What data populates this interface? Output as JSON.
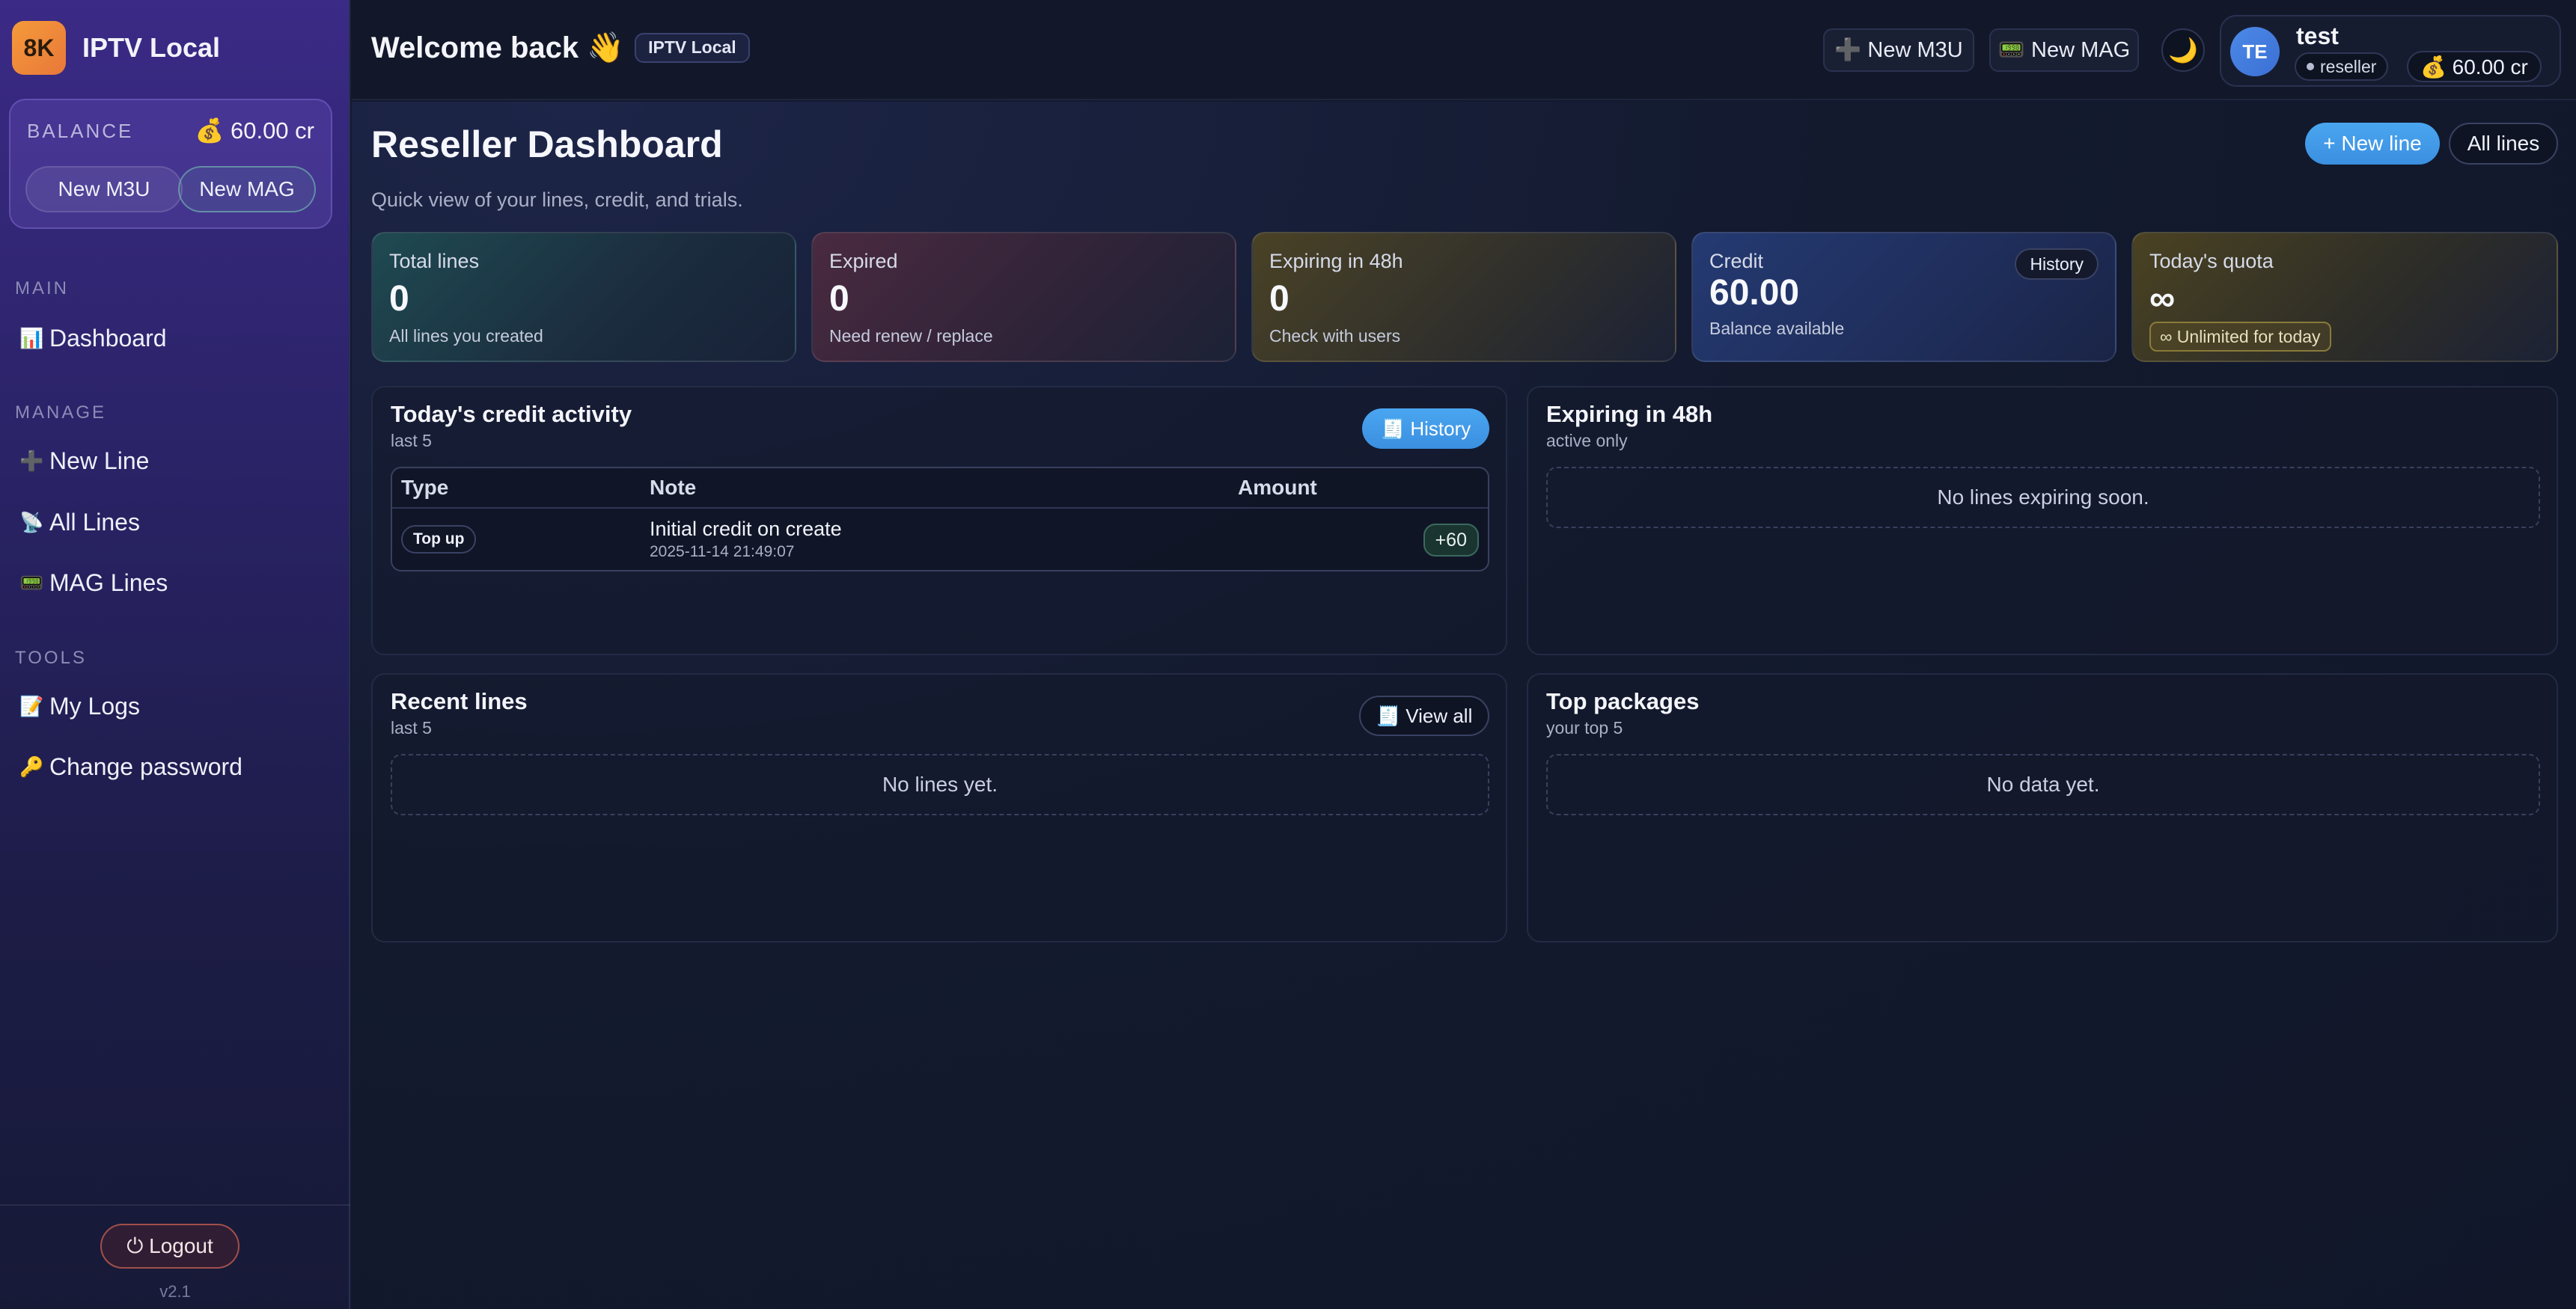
{
  "brand": {
    "logo_text": "8K",
    "name": "IPTV Local"
  },
  "balance": {
    "label": "BALANCE",
    "value": "💰 60.00 cr",
    "new_m3u": "New M3U",
    "new_mag": "New MAG"
  },
  "nav": {
    "main_label": "MAIN",
    "dashboard": {
      "icon": "📊",
      "label": "Dashboard"
    },
    "manage_label": "MANAGE",
    "new_line": {
      "icon": "➕",
      "label": "New Line"
    },
    "all_lines": {
      "icon": "📡",
      "label": "All Lines"
    },
    "mag_lines": {
      "icon": "📟",
      "label": "MAG Lines"
    },
    "tools_label": "TOOLS",
    "my_logs": {
      "icon": "📝",
      "label": "My Logs"
    },
    "change_password": {
      "icon": "🔑",
      "label": "Change password"
    }
  },
  "sidebar_footer": {
    "logout": "⏻ Logout",
    "version": "v2.1"
  },
  "topbar": {
    "welcome": "Welcome back 👋",
    "tag": "IPTV Local",
    "new_m3u": "➕ New M3U",
    "new_mag": "📟 New MAG",
    "theme_icon": "🌙"
  },
  "user": {
    "initials": "TE",
    "name": "test",
    "role": "reseller",
    "credit": "💰 60.00 cr"
  },
  "page": {
    "title": "Reseller Dashboard",
    "subtitle": "Quick view of your lines, credit, and trials.",
    "new_line_btn": "+ New line",
    "all_lines_btn": "All lines"
  },
  "stats": {
    "total_lines": {
      "label": "Total lines",
      "value": "0",
      "desc": "All lines you created"
    },
    "expired": {
      "label": "Expired",
      "value": "0",
      "desc": "Need renew / replace"
    },
    "expiring": {
      "label": "Expiring in 48h",
      "value": "0",
      "desc": "Check with users"
    },
    "credit": {
      "label": "Credit",
      "value": "60.00",
      "desc": "Balance available",
      "history": "History"
    },
    "quota": {
      "label": "Today's quota",
      "value": "∞",
      "chip": "∞ Unlimited for today"
    }
  },
  "credit_activity": {
    "title": "Today's credit activity",
    "sub": "last 5",
    "history_btn": "🧾 History",
    "columns": [
      "Type",
      "Note",
      "Amount"
    ],
    "rows": [
      {
        "type": "Top up",
        "note": "Initial credit on create",
        "date": "2025-11-14 21:49:07",
        "amount": "+60"
      }
    ]
  },
  "expiring_panel": {
    "title": "Expiring in 48h",
    "sub": "active only",
    "empty": "No lines expiring soon."
  },
  "recent_lines": {
    "title": "Recent lines",
    "sub": "last 5",
    "view_all": "🧾 View all",
    "empty": "No lines yet."
  },
  "top_packages": {
    "title": "Top packages",
    "sub": "your top 5",
    "empty": "No data yet."
  },
  "colors": {
    "accent": "#3b8fe0",
    "brand": "#e8783a",
    "background": "#131a2e"
  }
}
